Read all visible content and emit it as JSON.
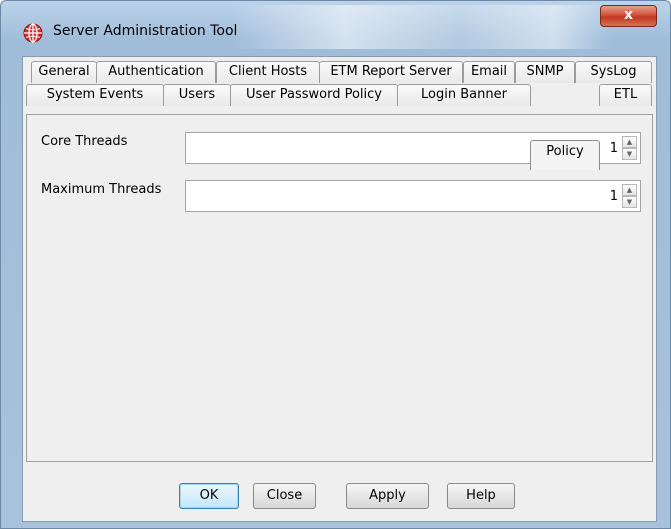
{
  "window": {
    "title": "Server Administration Tool",
    "close_label": "x"
  },
  "tabs": {
    "row1": [
      "General",
      "Authentication",
      "Client Hosts",
      "ETM Report Server",
      "Email",
      "SNMP",
      "SysLog"
    ],
    "row2": [
      "System Events",
      "Users",
      "User Password Policy",
      "Login Banner",
      "Policy",
      "ETL"
    ],
    "active": "Policy"
  },
  "form": {
    "core_threads_label": "Core Threads",
    "core_threads_value": "1",
    "max_threads_label": "Maximum Threads",
    "max_threads_value": "1"
  },
  "buttons": {
    "ok": "OK",
    "close": "Close",
    "apply": "Apply",
    "help": "Help"
  },
  "colors": {
    "title_gradient": "#a9c2dc",
    "close_button": "#c03a22",
    "default_button_border": "#3c7fb1",
    "panel_background": "#efefef"
  }
}
